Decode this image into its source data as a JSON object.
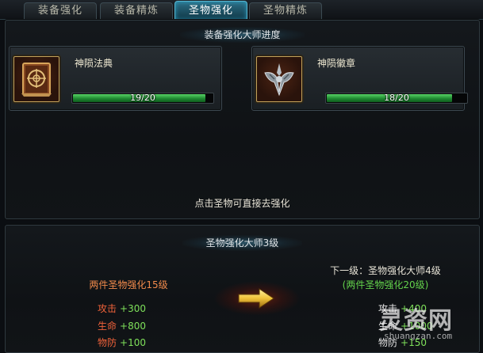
{
  "tabs": [
    {
      "label": "装备强化",
      "active": false
    },
    {
      "label": "装备精炼",
      "active": false
    },
    {
      "label": "圣物强化",
      "active": true
    },
    {
      "label": "圣物精炼",
      "active": false
    }
  ],
  "master_progress": {
    "title": "装备强化大师进度",
    "items": [
      {
        "name": "神陨法典",
        "progress_text": "19/20",
        "progress": 0.95,
        "icon": "tome-icon"
      },
      {
        "name": "神陨徽章",
        "progress_text": "18/20",
        "progress": 0.9,
        "icon": "emblem-icon"
      }
    ],
    "hint": "点击圣物可直接去强化"
  },
  "master_level": {
    "title": "圣物强化大师3级",
    "current": {
      "requirement": "两件圣物强化15级",
      "stats": [
        {
          "name": "攻击",
          "value": "+300"
        },
        {
          "name": "生命",
          "value": "+800"
        },
        {
          "name": "物防",
          "value": "+100"
        }
      ]
    },
    "next": {
      "title": "下一级：圣物强化大师4级",
      "requirement": "(两件圣物强化20级)",
      "stats": [
        {
          "name": "攻击",
          "value": "+400"
        },
        {
          "name": "生命",
          "value": "+1000"
        },
        {
          "name": "物防",
          "value": "+150"
        }
      ]
    },
    "arrow_icon": "right-arrow-icon"
  },
  "watermark": {
    "logo_text": "灵资网",
    "url": "shuangzan.com"
  },
  "colors": {
    "accent_blue": "#2d6f86",
    "progress_green": "#3fb54d",
    "stat_label": "#f0623a",
    "stat_value": "#7ee05a",
    "requirement_orange": "#f08a4b",
    "next_requirement_green": "#63d24b"
  }
}
